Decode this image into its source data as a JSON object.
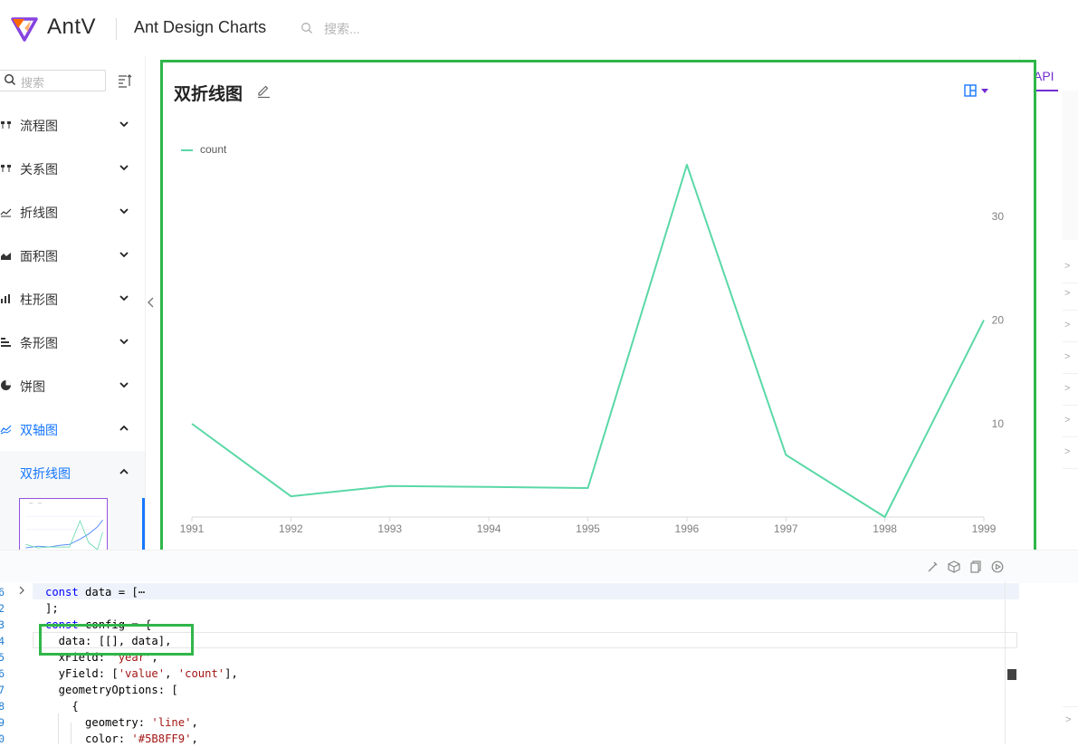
{
  "header": {
    "logo_text": "AntV",
    "site_title": "Ant Design Charts",
    "search_placeholder": "搜索..."
  },
  "sidebar": {
    "search_placeholder": "搜索",
    "items": [
      {
        "label": "流程图",
        "icon": "flow-icon"
      },
      {
        "label": "关系图",
        "icon": "relation-icon"
      },
      {
        "label": "折线图",
        "icon": "line-chart-icon"
      },
      {
        "label": "面积图",
        "icon": "area-chart-icon"
      },
      {
        "label": "柱形图",
        "icon": "column-chart-icon"
      },
      {
        "label": "条形图",
        "icon": "bar-chart-icon"
      },
      {
        "label": "饼图",
        "icon": "pie-chart-icon"
      },
      {
        "label": "双轴图",
        "icon": "dual-axes-icon",
        "active": true
      }
    ],
    "sub_item": {
      "label": "双折线图"
    }
  },
  "chart_card": {
    "title": "双折线图",
    "legend": "count"
  },
  "chart_data": {
    "type": "line",
    "x": [
      "1991",
      "1992",
      "1993",
      "1994",
      "1995",
      "1996",
      "1997",
      "1998",
      "1999"
    ],
    "series": [
      {
        "name": "count",
        "values": [
          10,
          3,
          4,
          3.9,
          3.8,
          35,
          7,
          1,
          20
        ],
        "color": "#5ad8a6"
      }
    ],
    "right_axis_ticks": [
      "10",
      "20",
      "30"
    ],
    "ylim": [
      1,
      35
    ],
    "grid": false,
    "legend_position": "top-left"
  },
  "right_panel": {
    "tab": "API"
  },
  "code": {
    "lines": [
      {
        "n": "6",
        "text": "const data = [⋯"
      },
      {
        "n": "2",
        "text": "];"
      },
      {
        "n": "3",
        "text": "const config = {"
      },
      {
        "n": "4",
        "text": "  data: [[], data],"
      },
      {
        "n": "5",
        "text": "  xField: 'year',"
      },
      {
        "n": "6",
        "text": "  yField: ['value', 'count'],"
      },
      {
        "n": "7",
        "text": "  geometryOptions: ["
      },
      {
        "n": "8",
        "text": "    {"
      },
      {
        "n": "9",
        "text": "      geometry: 'line',"
      },
      {
        "n": "0",
        "text": "      color: '#5B8FF9',"
      }
    ]
  },
  "colors": {
    "accent": "#1677ff",
    "highlight_box": "#2fb64a",
    "series": "#5ad8a6",
    "tab": "#722ed1"
  }
}
